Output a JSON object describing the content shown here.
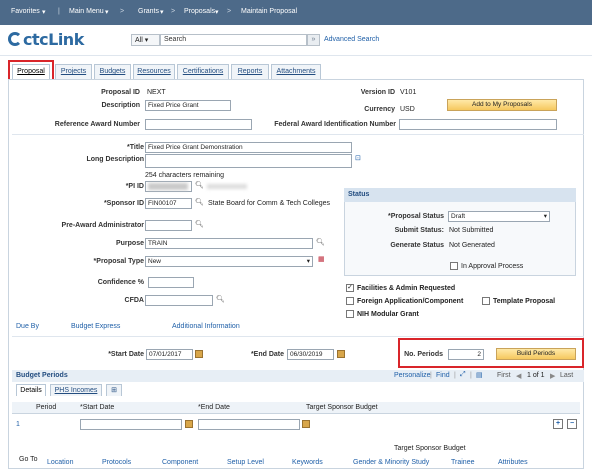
{
  "nav": {
    "favorites": "Favorites",
    "main_menu": "Main Menu",
    "grants": "Grants",
    "proposals": "Proposals",
    "current": "Maintain Proposal",
    "sep": ">"
  },
  "header": {
    "logo_text": "ctcLink",
    "search_scope": "All",
    "search_placeholder": "Search",
    "advanced_search": "Advanced Search"
  },
  "tabs": [
    "Proposal",
    "Projects",
    "Budgets",
    "Resources",
    "Certifications",
    "Reports",
    "Attachments"
  ],
  "proposal": {
    "proposal_id_label": "Proposal ID",
    "proposal_id": "NEXT",
    "version_id_label": "Version ID",
    "version_id": "V101",
    "description_label": "Description",
    "description": "Fixed Price Grant",
    "currency_label": "Currency",
    "currency": "USD",
    "add_my_proposals": "Add to My Proposals",
    "ref_award_label": "Reference Award Number",
    "federal_award_label": "Federal Award Identification Number",
    "title_label": "*Title",
    "title": "Fixed Price Grant Demonstration",
    "long_desc_label": "Long Description",
    "chars_remaining": "254 characters remaining",
    "pi_label": "*PI ID",
    "sponsor_label": "*Sponsor ID",
    "sponsor_id": "FIN00107",
    "sponsor_name": "State Board for Comm & Tech Colleges",
    "pre_award_label": "Pre-Award Administrator",
    "purpose_label": "Purpose",
    "purpose": "TRAIN",
    "proposal_type_label": "*Proposal Type",
    "proposal_type": "New",
    "confidence_label": "Confidence %",
    "cfda_label": "CFDA"
  },
  "status": {
    "header": "Status",
    "proposal_status_label": "*Proposal Status",
    "proposal_status": "Draft",
    "submit_status_label": "Submit Status:",
    "submit_status": "Not Submitted",
    "generate_status_label": "Generate Status",
    "generate_status": "Not Generated",
    "in_approval": "In Approval Process"
  },
  "checks": {
    "facilities": "Facilities & Admin Requested",
    "foreign": "Foreign Application/Component",
    "template": "Template Proposal",
    "nih": "NIH Modular Grant"
  },
  "links": {
    "due_by": "Due By",
    "budget_express": "Budget Express",
    "additional_info": "Additional Information"
  },
  "dates": {
    "start_label": "*Start Date",
    "start": "07/01/2017",
    "end_label": "*End Date",
    "end": "06/30/2019",
    "no_periods_label": "No. Periods",
    "no_periods": "2",
    "build_periods": "Build Periods"
  },
  "budget_periods": {
    "title": "Budget Periods",
    "personalize": "Personalize",
    "find": "Find",
    "first": "First",
    "pagination": "1 of 1",
    "last": "Last",
    "subtabs": [
      "Details",
      "PHS Incomes"
    ],
    "columns": [
      "Period",
      "*Start Date",
      "*End Date",
      "Target Sponsor Budget"
    ],
    "row_period": "1"
  },
  "footer": {
    "target_sponsor_budget": "Target Sponsor Budget",
    "goto": "Go To",
    "links": [
      "Location",
      "Protocols",
      "Component",
      "Setup Level",
      "Keywords",
      "Gender & Minority Study",
      "Trainee",
      "Attributes"
    ]
  }
}
